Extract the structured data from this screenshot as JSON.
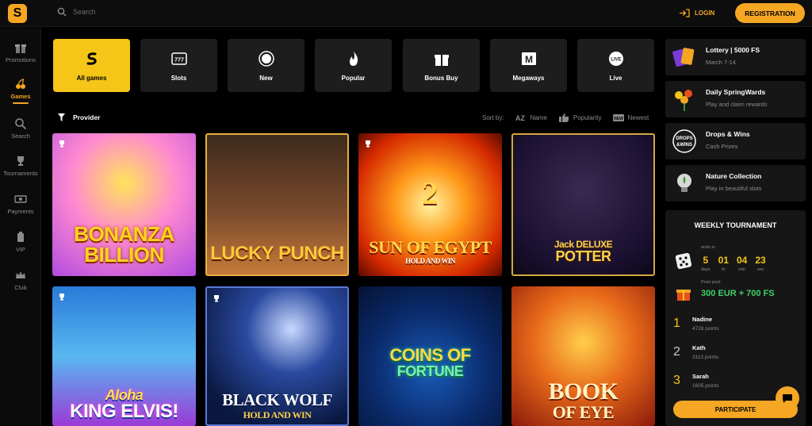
{
  "header": {
    "search_placeholder": "Search",
    "login_label": "LOGIN",
    "register_label": "REGISTRATION"
  },
  "sidebar": {
    "items": [
      {
        "label": "Promotions",
        "icon": "gift-icon"
      },
      {
        "label": "Games",
        "icon": "cherries-icon",
        "active": true
      },
      {
        "label": "Search",
        "icon": "search-icon"
      },
      {
        "label": "Tournaments",
        "icon": "trophy-icon"
      },
      {
        "label": "Payments",
        "icon": "cash-icon"
      },
      {
        "label": "VIP",
        "icon": "badge-icon"
      },
      {
        "label": "Club",
        "icon": "crown-icon"
      }
    ]
  },
  "categories": [
    {
      "label": "All games",
      "icon": "s-logo-icon",
      "active": true
    },
    {
      "label": "Slots",
      "icon": "slot-machine-icon"
    },
    {
      "label": "New",
      "icon": "new-badge-icon"
    },
    {
      "label": "Popular",
      "icon": "flame-icon"
    },
    {
      "label": "Bonus Buy",
      "icon": "gift-box-icon"
    },
    {
      "label": "Megaways",
      "icon": "megaways-icon"
    },
    {
      "label": "Live",
      "icon": "live-icon"
    }
  ],
  "filters": {
    "provider_label": "Provider",
    "sort_label": "Sort by:",
    "sort_options": [
      {
        "label": "Name",
        "icon": "az-icon"
      },
      {
        "label": "Popularity",
        "icon": "thumbs-up-icon"
      },
      {
        "label": "Newest",
        "icon": "new-badge-icon"
      }
    ]
  },
  "games": [
    {
      "title_line1": "BONANZA",
      "title_line2": "BILLION",
      "trophy": true
    },
    {
      "title_line1": "LUCKY PUNCH",
      "title_line2": "",
      "trophy": false
    },
    {
      "title_line1": "SUN OF EGYPT",
      "title_line2": "HOLD AND WIN",
      "prefix": "2",
      "trophy": true
    },
    {
      "title_line1": "Jack DELUXE",
      "title_line2": "POTTER",
      "trophy": false
    },
    {
      "title_line1": "Aloha",
      "title_line2": "KING ELVIS!",
      "trophy": true
    },
    {
      "title_line1": "BLACK WOLF",
      "title_line2": "HOLD AND WIN",
      "trophy": true
    },
    {
      "title_line1": "COINS OF",
      "title_line2": "FORTUNE",
      "trophy": false
    },
    {
      "title_line1": "BOOK",
      "title_line2": "OF EYE",
      "trophy": false
    }
  ],
  "promotions": [
    {
      "title": "Lottery | 5000 FS",
      "subtitle": "March 7-14",
      "icon": "lottery-ticket-icon"
    },
    {
      "title": "Daily SpringWards",
      "subtitle": "Play and claim rewards",
      "icon": "flower-bouquet-icon"
    },
    {
      "title": "Drops & Wins",
      "subtitle": "Cash Prizes",
      "icon": "drops-wins-icon"
    },
    {
      "title": "Nature Collection",
      "subtitle": "Play in beautiful slots",
      "icon": "lightbulb-icon"
    }
  ],
  "tournament": {
    "title": "WEEKLY TOURNAMENT",
    "ends_in_label": "ends in",
    "countdown": [
      {
        "value": "5",
        "unit": "days"
      },
      {
        "value": "01",
        "unit": "hr"
      },
      {
        "value": "04",
        "unit": "min"
      },
      {
        "value": "23",
        "unit": "sec"
      }
    ],
    "prize_pool_label": "Prize pool",
    "prize_pool": "300 EUR + 700 FS",
    "leaders": [
      {
        "rank": "1",
        "name": "Nadine",
        "points": "4728 points"
      },
      {
        "rank": "2",
        "name": "Kath",
        "points": "3113 points"
      },
      {
        "rank": "3",
        "name": "Sarah",
        "points": "1605 points"
      }
    ],
    "participate_label": "PARTICIPATE"
  },
  "colors": {
    "accent": "#f5a623",
    "active_tile": "#f5c518",
    "prize_green": "#3fd16a"
  }
}
